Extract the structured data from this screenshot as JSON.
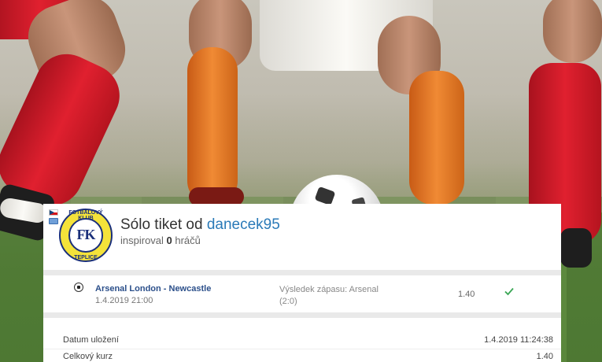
{
  "ticket": {
    "title_prefix": "Sólo tiket od ",
    "username": "danecek95",
    "inspired_prefix": "inspiroval ",
    "inspired_count": "0",
    "inspired_suffix": " hráčů",
    "club_logo": {
      "top_text": "FOTBALOVÝ KLUB",
      "letters": "FK",
      "bottom_text": "TEPLICE"
    },
    "country_flag": "czech-flag-icon"
  },
  "bet": {
    "match": "Arsenal London - Newcastle",
    "datetime": "1.4.2019 21:00",
    "market_line1": "Výsledek zápasu: Arsenal",
    "market_line2": "(2:0)",
    "odds": "1.40",
    "status_icon": "check-icon",
    "status_color": "#3aa655"
  },
  "summary": {
    "rows": [
      {
        "label": "Datum uložení",
        "value": "1.4.2019 11:24:38"
      },
      {
        "label": "Celkový kurz",
        "value": "1.40"
      }
    ]
  },
  "colors": {
    "username": "#2a7ab8",
    "match_link": "#2b4f8a",
    "divider": "#e9e9e9"
  }
}
